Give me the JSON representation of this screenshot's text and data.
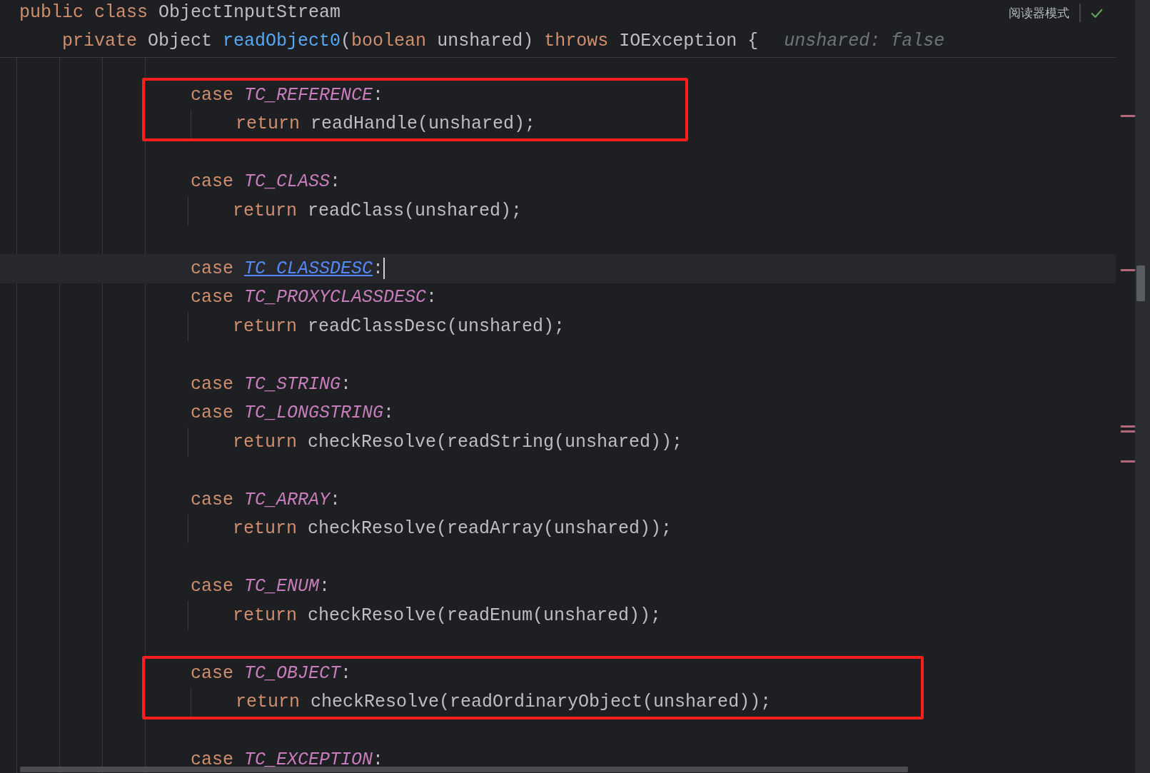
{
  "header": {
    "lines": [
      {
        "kind": "class",
        "tokens": [
          {
            "kind": "keyword",
            "text": "public class "
          },
          {
            "kind": "text",
            "text": "ObjectInputStream"
          }
        ]
      },
      {
        "kind": "method",
        "tokens": [
          {
            "kind": "keyword",
            "text": "private "
          },
          {
            "kind": "text",
            "text": "Object "
          },
          {
            "kind": "method",
            "text": "readObject0"
          },
          {
            "kind": "text",
            "text": "("
          },
          {
            "kind": "keyword",
            "text": "boolean "
          },
          {
            "kind": "text",
            "text": "unshared) "
          },
          {
            "kind": "keyword",
            "text": "throws "
          },
          {
            "kind": "text",
            "text": "IOException {"
          },
          {
            "kind": "hint",
            "text": "unshared: false"
          }
        ]
      }
    ],
    "reader_mode": "阅读器模式"
  },
  "code": {
    "blocks": [
      {
        "boxed": true,
        "lines": [
          {
            "kind": "case",
            "current": false,
            "tokens": [
              {
                "kind": "keyword",
                "text": "case "
              },
              {
                "kind": "constant",
                "text": "TC_REFERENCE"
              },
              {
                "kind": "text",
                "text": ":"
              }
            ]
          },
          {
            "kind": "statement",
            "current": false,
            "tokens": [
              {
                "kind": "keyword",
                "text": "return "
              },
              {
                "kind": "text",
                "text": "readHandle(unshared);"
              }
            ]
          }
        ]
      },
      {
        "boxed": false,
        "lines": [
          {
            "kind": "blank",
            "current": false
          },
          {
            "kind": "case",
            "current": false,
            "tokens": [
              {
                "kind": "keyword",
                "text": "case "
              },
              {
                "kind": "constant",
                "text": "TC_CLASS"
              },
              {
                "kind": "text",
                "text": ":"
              }
            ]
          },
          {
            "kind": "statement",
            "current": false,
            "tokens": [
              {
                "kind": "keyword",
                "text": "return "
              },
              {
                "kind": "text",
                "text": "readClass(unshared);"
              }
            ]
          },
          {
            "kind": "blank",
            "current": false
          },
          {
            "kind": "case",
            "current": true,
            "tokens": [
              {
                "kind": "keyword",
                "text": "case "
              },
              {
                "kind": "link",
                "text": "TC_CLASSDESC"
              },
              {
                "kind": "text",
                "text": ":"
              }
            ]
          },
          {
            "kind": "case",
            "current": false,
            "tokens": [
              {
                "kind": "keyword",
                "text": "case "
              },
              {
                "kind": "constant",
                "text": "TC_PROXYCLASSDESC"
              },
              {
                "kind": "text",
                "text": ":"
              }
            ]
          },
          {
            "kind": "statement",
            "current": false,
            "tokens": [
              {
                "kind": "keyword",
                "text": "return "
              },
              {
                "kind": "text",
                "text": "readClassDesc(unshared);"
              }
            ]
          },
          {
            "kind": "blank",
            "current": false
          },
          {
            "kind": "case",
            "current": false,
            "tokens": [
              {
                "kind": "keyword",
                "text": "case "
              },
              {
                "kind": "constant",
                "text": "TC_STRING"
              },
              {
                "kind": "text",
                "text": ":"
              }
            ]
          },
          {
            "kind": "case",
            "current": false,
            "tokens": [
              {
                "kind": "keyword",
                "text": "case "
              },
              {
                "kind": "constant",
                "text": "TC_LONGSTRING"
              },
              {
                "kind": "text",
                "text": ":"
              }
            ]
          },
          {
            "kind": "statement",
            "current": false,
            "tokens": [
              {
                "kind": "keyword",
                "text": "return "
              },
              {
                "kind": "text",
                "text": "checkResolve(readString(unshared));"
              }
            ]
          },
          {
            "kind": "blank",
            "current": false
          },
          {
            "kind": "case",
            "current": false,
            "tokens": [
              {
                "kind": "keyword",
                "text": "case "
              },
              {
                "kind": "constant",
                "text": "TC_ARRAY"
              },
              {
                "kind": "text",
                "text": ":"
              }
            ]
          },
          {
            "kind": "statement",
            "current": false,
            "tokens": [
              {
                "kind": "keyword",
                "text": "return "
              },
              {
                "kind": "text",
                "text": "checkResolve(readArray(unshared));"
              }
            ]
          },
          {
            "kind": "blank",
            "current": false
          },
          {
            "kind": "case",
            "current": false,
            "tokens": [
              {
                "kind": "keyword",
                "text": "case "
              },
              {
                "kind": "constant",
                "text": "TC_ENUM"
              },
              {
                "kind": "text",
                "text": ":"
              }
            ]
          },
          {
            "kind": "statement",
            "current": false,
            "tokens": [
              {
                "kind": "keyword",
                "text": "return "
              },
              {
                "kind": "text",
                "text": "checkResolve(readEnum(unshared));"
              }
            ]
          },
          {
            "kind": "blank",
            "current": false
          }
        ]
      },
      {
        "boxed": true,
        "lines": [
          {
            "kind": "case",
            "current": false,
            "tokens": [
              {
                "kind": "keyword",
                "text": "case "
              },
              {
                "kind": "constant",
                "text": "TC_OBJECT"
              },
              {
                "kind": "text",
                "text": ":"
              }
            ]
          },
          {
            "kind": "statement",
            "current": false,
            "tokens": [
              {
                "kind": "keyword",
                "text": "return "
              },
              {
                "kind": "text",
                "text": "checkResolve(readOrdinaryObject(unshared));"
              }
            ]
          }
        ]
      },
      {
        "boxed": false,
        "lines": [
          {
            "kind": "blank",
            "current": false
          },
          {
            "kind": "case",
            "current": false,
            "tokens": [
              {
                "kind": "keyword",
                "text": "case "
              },
              {
                "kind": "constant",
                "text": "TC_EXCEPTION"
              },
              {
                "kind": "text",
                "text": ":"
              }
            ]
          }
        ]
      }
    ]
  }
}
